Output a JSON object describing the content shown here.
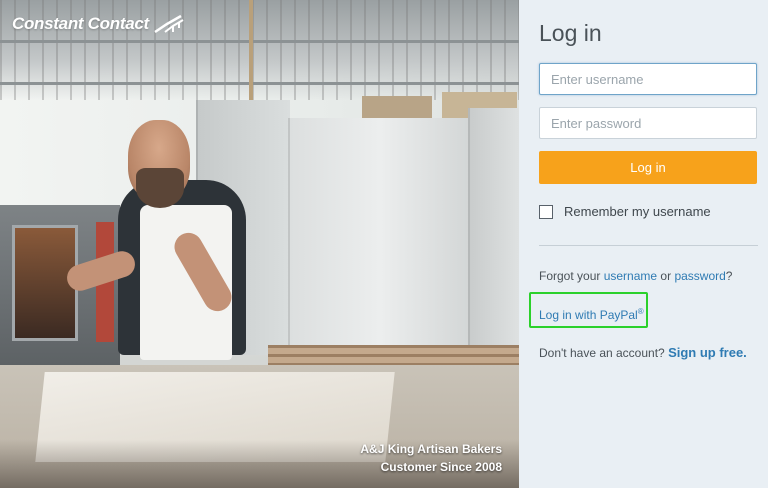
{
  "brand": {
    "logo_text": "Constant Contact",
    "logo_icon": "logo-swoosh-icon"
  },
  "hero": {
    "caption_line1": "A&J King Artisan Bakers",
    "caption_line2": "Customer Since 2008"
  },
  "login": {
    "title": "Log in",
    "username_placeholder": "Enter username",
    "username_value": "",
    "password_placeholder": "Enter password",
    "password_value": "",
    "submit_label": "Log in",
    "remember_label": "Remember my username",
    "remember_checked": false,
    "forgot_prefix": "Forgot your",
    "forgot_username": "username",
    "forgot_or": "or",
    "forgot_password": "password",
    "forgot_suffix": "?",
    "paypal_label": "Log in with PayPal",
    "paypal_mark": "®",
    "signup_prefix": "Don't have an account?",
    "signup_label": "Sign up free."
  },
  "colors": {
    "accent": "#f7a21b",
    "link": "#2f7bb3",
    "panel_bg": "#e9eff4",
    "highlight": "#2bd12b"
  }
}
